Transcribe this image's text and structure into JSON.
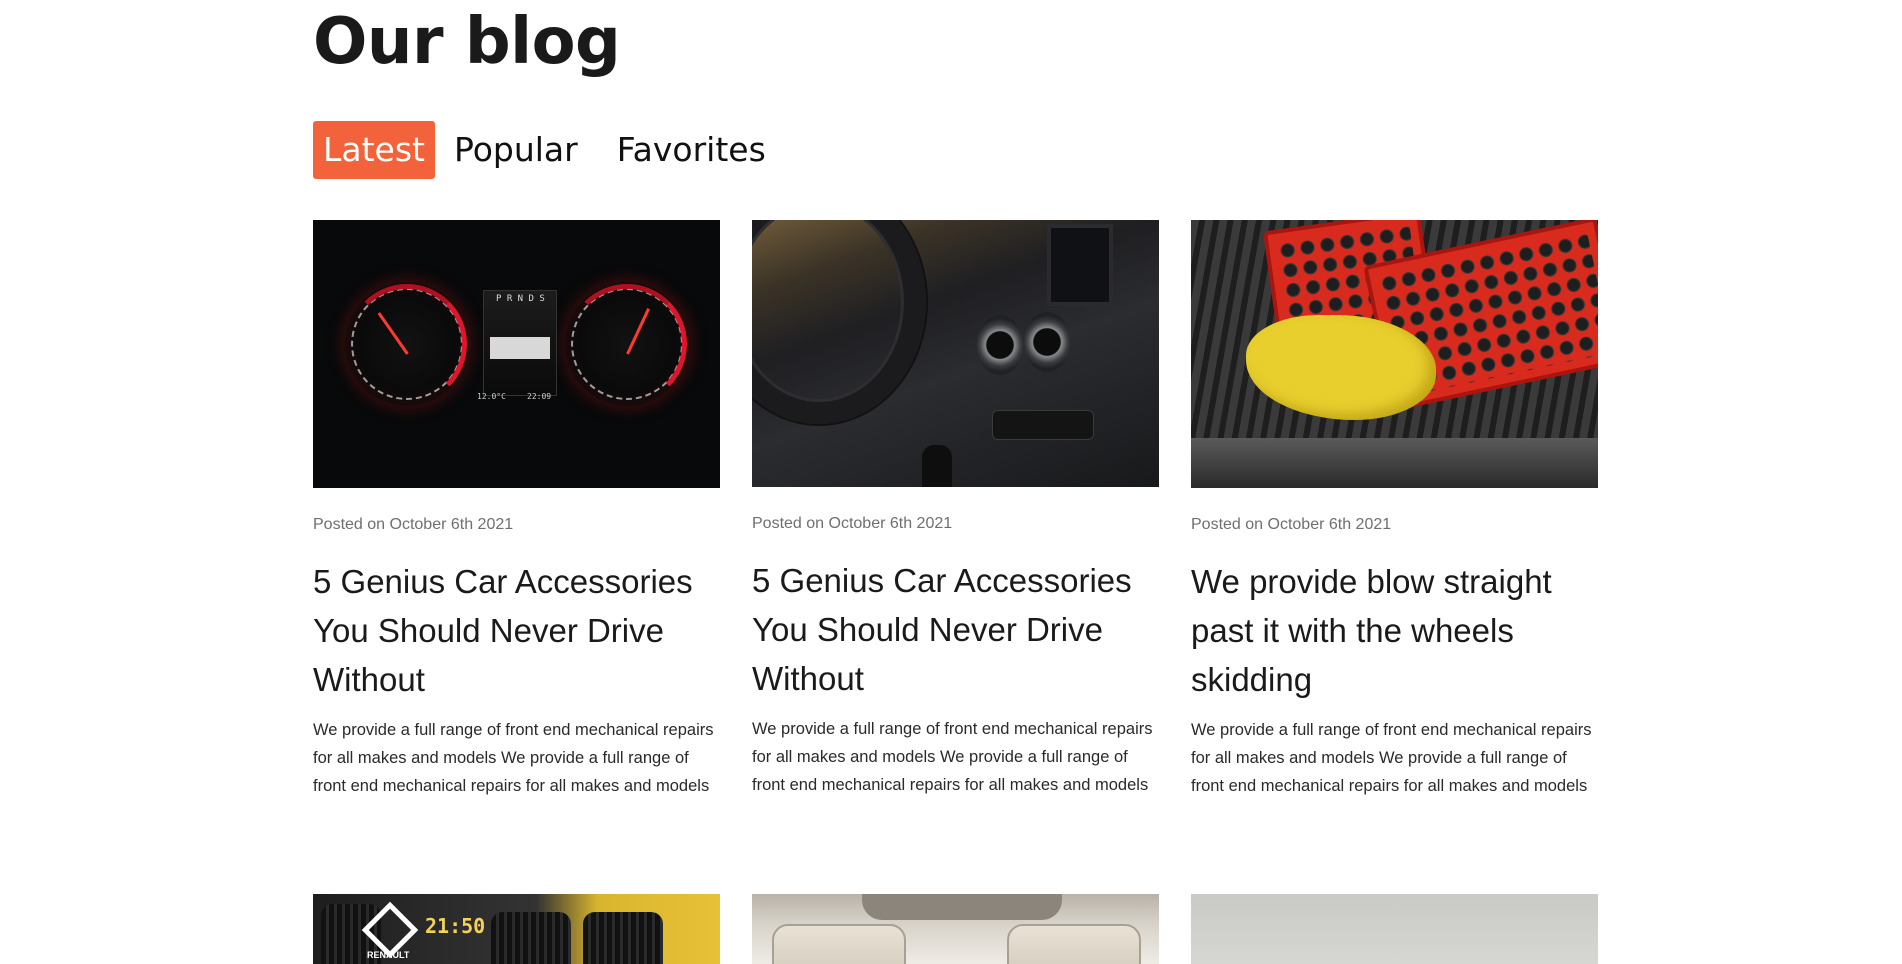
{
  "page": {
    "title": "Our blog"
  },
  "tabs": [
    {
      "label": "Latest",
      "active": true
    },
    {
      "label": "Popular",
      "active": false
    },
    {
      "label": "Favorites",
      "active": false
    }
  ],
  "colors": {
    "accent": "#f2623b",
    "text": "#1a1a1a",
    "muted": "#6f6f6f"
  },
  "posts": [
    {
      "date": "Posted on October 6th 2021",
      "title": "5 Genius Car Accessories You Should Never Drive Without",
      "excerpt": "We provide a full range of front end mechanical repairs for all makes and models We provide a full range of front end mechanical repairs for all makes and models",
      "image": "speedometer-dashboard-photo",
      "image_text": {
        "gear": "P R N D S",
        "temp": "12.0°C",
        "time": "22:09"
      }
    },
    {
      "date": "Posted on October 6th 2021",
      "title": "5 Genius Car Accessories You Should Never Drive Without",
      "excerpt": "We provide a full range of front end mechanical repairs for all makes and models We provide a full range of front end mechanical repairs for all makes and models",
      "image": "car-interior-photo"
    },
    {
      "date": "Posted on October 6th 2021",
      "title": "We provide blow straight past it with the wheels skidding",
      "excerpt": "We provide a full range of front end mechanical repairs for all makes and models We provide a full range of front end mechanical repairs for all makes and models",
      "image": "socket-set-photo"
    },
    {
      "image": "garage-tires-photo",
      "image_text": {
        "clock": "21:50",
        "brand": "RENAULT"
      }
    },
    {
      "image": "car-seats-photo"
    },
    {
      "image": "plain-photo"
    }
  ]
}
